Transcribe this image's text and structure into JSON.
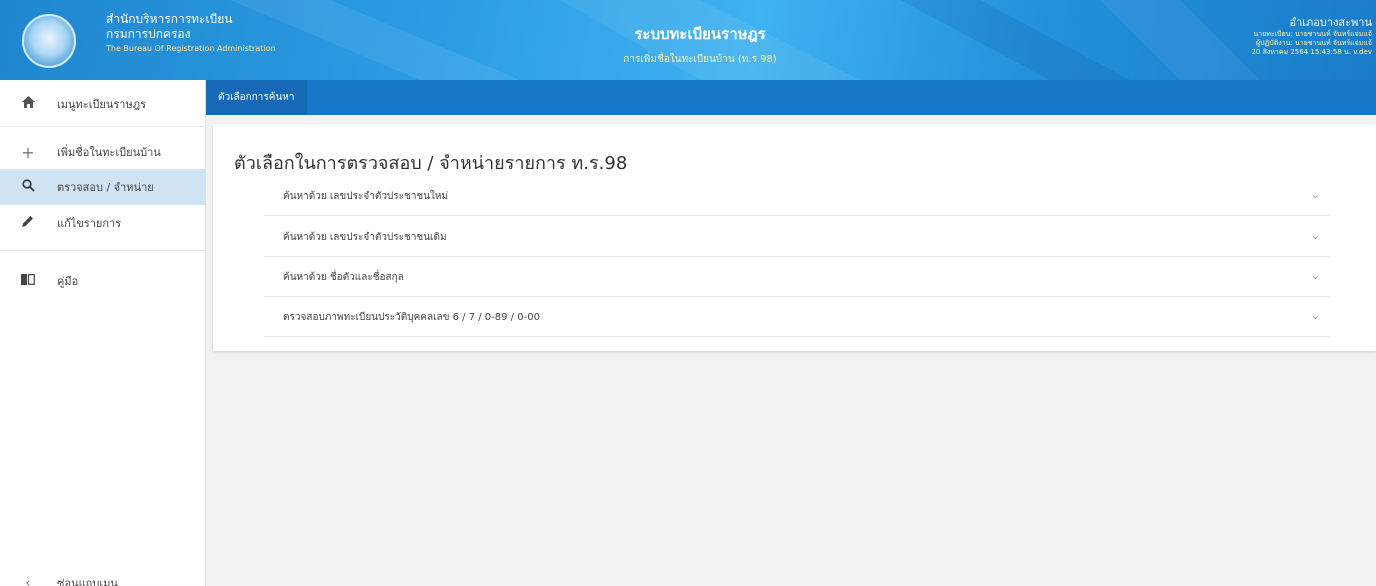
{
  "header": {
    "org_line1": "สำนักบริหารการทะเบียน",
    "org_line2": "กรมการปกครอง",
    "org_line3": "The Bureau Of Registration Administration",
    "system_title": "ระบบทะเบียนราษฎร",
    "system_subtitle": "การเพิ่มชื่อในทะเบียนบ้าน (ท.ร.98)",
    "office_name": "อำเภอบางสะพาน",
    "registrar": "นายทะเบียน: นายชานนท์ จันทร์แจ่มแจ้",
    "operator": "ผู้ปฏิบัติงาน: นายชานนท์ จันทร์แจ่มแจ้",
    "datetime": "20 สิงหาคม 2564 15:43:58 น.  v.dev"
  },
  "sidebar": {
    "items": [
      {
        "label": "เมนูทะเบียนราษฎร",
        "icon": "home-icon"
      },
      {
        "label": "เพิ่มชื่อในทะเบียนบ้าน",
        "icon": "plus-icon"
      },
      {
        "label": "ตรวจสอบ / จำหน่าย",
        "icon": "search-icon"
      },
      {
        "label": "แก้ไขรายการ",
        "icon": "pencil-icon"
      },
      {
        "label": "คู่มือ",
        "icon": "book-icon"
      }
    ],
    "collapse_label": "ซ่อนแถบเมนู"
  },
  "tabs": {
    "active_label": "ตัวเลือกการค้นหา"
  },
  "main": {
    "title": "ตัวเลือกในการตรวจสอบ / จำหน่ายรายการ ท.ร.98",
    "options": [
      "ค้นหาด้วย เลขประจำตัวประชาชนใหม่",
      "ค้นหาด้วย เลขประจำตัวประชาชนเดิม",
      "ค้นหาด้วย ชื่อตัวและชื่อสกุล",
      "ตรวจสอบภาพทะเบียนประวัติบุคคลเลข 6 / 7 / 0-89 / 0-00"
    ]
  },
  "colors": {
    "header_blue": "#1f86cf",
    "tabbar_blue": "#1676c8",
    "active_item_bg": "#cfe3f5"
  }
}
